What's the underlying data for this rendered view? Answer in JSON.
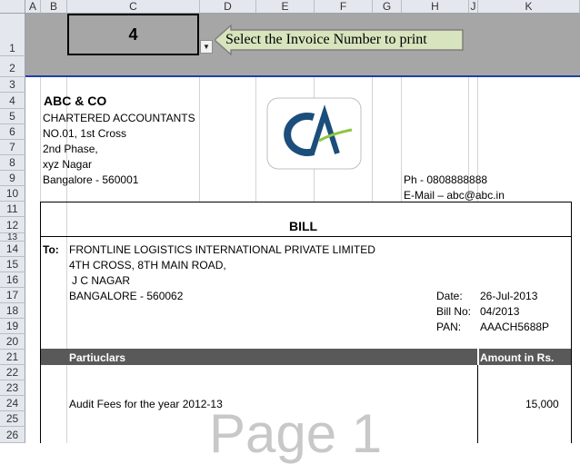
{
  "columns": [
    "A",
    "B",
    "C",
    "D",
    "E",
    "F",
    "G",
    "H",
    "J",
    "K"
  ],
  "rows": [
    "1",
    "2",
    "3",
    "4",
    "5",
    "6",
    "7",
    "8",
    "9",
    "10",
    "11",
    "12",
    "13",
    "14",
    "15",
    "16",
    "17",
    "18",
    "19",
    "20",
    "21",
    "22",
    "23",
    "24",
    "25",
    "26"
  ],
  "selector": {
    "value": "4",
    "callout": "Select the Invoice Number to print"
  },
  "firm": {
    "name": "ABC & CO",
    "lines": [
      "CHARTERED ACCOUNTANTS",
      "NO.01, 1st Cross",
      "2nd Phase,",
      "xyz Nagar",
      "Bangalore - 560001"
    ],
    "phone": "Ph - 0808888888",
    "email": "E-Mail – abc@abc.in",
    "logo_text": "CA"
  },
  "bill": {
    "title": "BILL",
    "to_label": "To:",
    "to_lines": [
      "FRONTLINE LOGISTICS INTERNATIONAL PRIVATE LIMITED",
      "4TH CROSS, 8TH MAIN ROAD,",
      "J C NAGAR",
      "BANGALORE - 560062"
    ],
    "date_label": "Date:",
    "date": "26-Jul-2013",
    "billno_label": "Bill No:",
    "billno": "04/2013",
    "pan_label": "PAN:",
    "pan": "AAACH5688P",
    "col_particulars": "Partiuclars",
    "col_amount": "Amount in Rs.",
    "item_desc": "Audit Fees for the year 2012-13",
    "item_amount": "15,000"
  },
  "watermark": "Page 1",
  "colors": {
    "blue_line": "#1f3fae",
    "callout_fill": "#d7e4bd",
    "header_bar": "#595959",
    "logo_blue": "#1b4e7a",
    "logo_green": "#8dc63f"
  }
}
